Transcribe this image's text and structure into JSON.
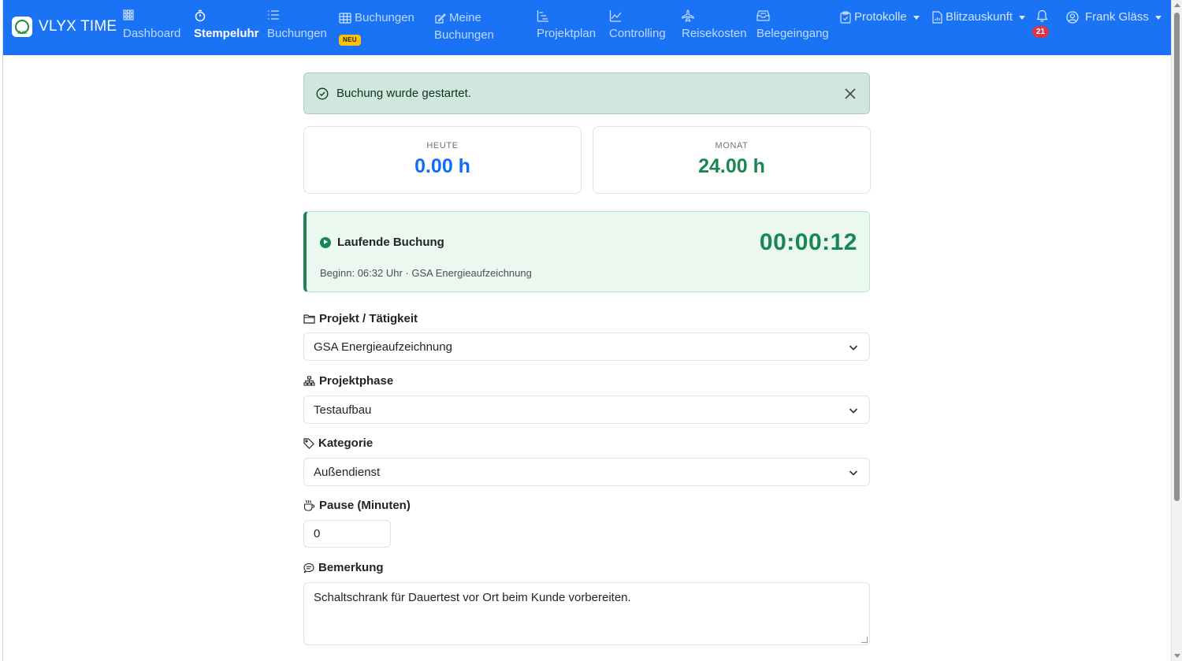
{
  "app": {
    "brand": "VLYX TIME",
    "logo_text": "VLYX"
  },
  "nav": {
    "items": [
      {
        "label": "Dashboard",
        "icon": "grid-icon",
        "active": false
      },
      {
        "label": "Stempeluhr",
        "icon": "stopwatch-icon",
        "active": true
      },
      {
        "label": "Buchungen",
        "icon": "list-icon",
        "active": false
      },
      {
        "label": "Buchungen",
        "icon": "table-icon",
        "badge": "NEU",
        "active": false
      },
      {
        "label_line1": "Meine",
        "label_line2": "Buchungen",
        "icon": "edit-icon",
        "active": false
      },
      {
        "label": "Projektplan",
        "icon": "gantt-icon",
        "active": false
      },
      {
        "label": "Controlling",
        "icon": "chart-line-icon",
        "active": false
      },
      {
        "label": "Reisekosten",
        "icon": "airplane-icon",
        "active": false
      },
      {
        "label": "Belegeingang",
        "icon": "inbox-icon",
        "active": false
      }
    ],
    "protokolle": "Protokolle",
    "blitzauskunft": "Blitzauskunft",
    "notifications_count": "21",
    "user": "Frank Gläss"
  },
  "alert": {
    "message": "Buchung wurde gestartet."
  },
  "stats": {
    "today_label": "HEUTE",
    "today_value": "0.00 h",
    "month_label": "MONAT",
    "month_value": "24.00 h"
  },
  "running": {
    "title": "Laufende Buchung",
    "timer": "00:00:12",
    "subtitle": "Beginn: 06:32 Uhr · GSA Energieaufzeichnung"
  },
  "form": {
    "project_label": "Projekt / Tätigkeit",
    "project_value": "GSA Energieaufzeichnung",
    "phase_label": "Projektphase",
    "phase_value": "Testaufbau",
    "category_label": "Kategorie",
    "category_value": "Außendienst",
    "pause_label": "Pause (Minuten)",
    "pause_value": "0",
    "remark_label": "Bemerkung",
    "remark_value": "Schaltschrank für Dauertest vor Ort beim Kunde vorbereiten."
  },
  "colors": {
    "navbar": "#1a73f5",
    "today_value": "#0d6efd",
    "month_value": "#198754",
    "timer": "#198754",
    "alert_bg": "#d1e7dd",
    "badge_neu": "#ffc107",
    "badge_count": "#dc3545"
  }
}
